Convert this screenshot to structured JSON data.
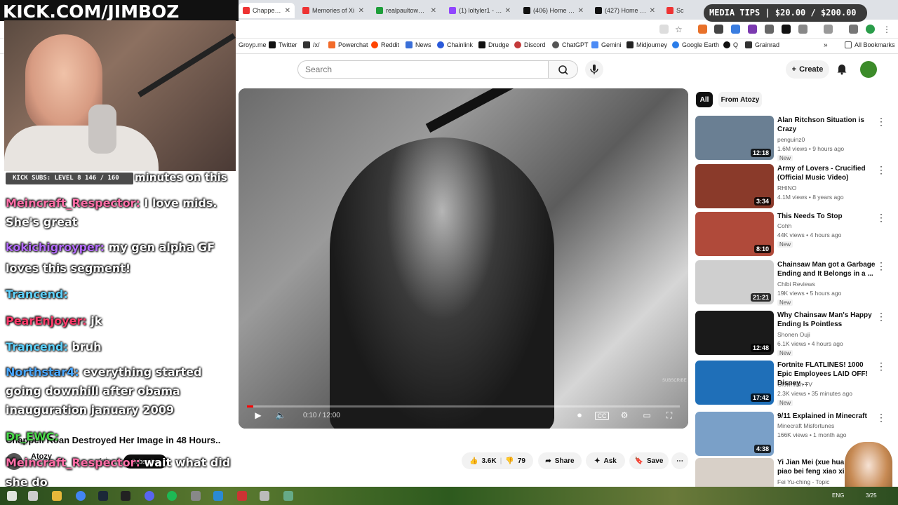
{
  "browser": {
    "tabs": [
      {
        "label": "Chappell Ro",
        "active": true,
        "color": "#e33"
      },
      {
        "label": "Memories of Xi",
        "color": "#e33"
      },
      {
        "label": "realpaultown Si",
        "color": "#1e9e3a"
      },
      {
        "label": "(1) loltyler1 - Te",
        "color": "#9146ff"
      },
      {
        "label": "(406) Home / X",
        "color": "#111"
      },
      {
        "label": "(427) Home / X",
        "color": "#111"
      },
      {
        "label": "Sc",
        "color": "#e33"
      }
    ],
    "bookmarks": [
      {
        "label": "Groyp.me",
        "color": "#8a5a44"
      },
      {
        "label": "Twitter",
        "color": "#111"
      },
      {
        "label": "/x/",
        "color": "#333"
      },
      {
        "label": "Powerchat",
        "color": "#f26b2a"
      },
      {
        "label": "Reddit",
        "color": "#ff4500"
      },
      {
        "label": "News",
        "color": "#3a6fd8"
      },
      {
        "label": "Chainlink",
        "color": "#2a5ada"
      },
      {
        "label": "Drudge",
        "color": "#111"
      },
      {
        "label": "Discord",
        "color": "#c43a3a"
      },
      {
        "label": "ChatGPT",
        "color": "#555"
      },
      {
        "label": "Gemini",
        "color": "#4c8bf5"
      },
      {
        "label": "Midjourney",
        "color": "#222"
      },
      {
        "label": "Google Earth",
        "color": "#2b7de9"
      },
      {
        "label": "Q",
        "color": "#111"
      },
      {
        "label": "Grainrad",
        "color": "#333"
      }
    ],
    "all_bookmarks": "All Bookmarks"
  },
  "youtube": {
    "search_placeholder": "Search",
    "create_label": "Create",
    "chips": [
      "All",
      "From Atozy"
    ],
    "video": {
      "title": "Chappell Roan Destroyed Her Image in 48 Hours..",
      "time": "0:10 / 12:00",
      "progress": 0.014,
      "watermark": "SUBSCRIBE",
      "channel": "Atozy",
      "join": "Join",
      "subscribe": "Subscribe",
      "likes": "3.6K",
      "dislikes": "79",
      "share": "Share",
      "ask": "Ask",
      "save": "Save"
    },
    "recommendations": [
      {
        "title": "Alan Ritchson Situation is Crazy",
        "channel": "penguinz0",
        "meta": "1.6M views • 9 hours ago",
        "badge": "New",
        "duration": "12:18",
        "thumb": "#6a7f93"
      },
      {
        "title": "Army of Lovers - Crucified (Official Music Video)",
        "channel": "RHINO",
        "meta": "4.1M views • 8 years ago",
        "badge": "",
        "duration": "3:34",
        "thumb": "#8a3a2a"
      },
      {
        "title": "This Needs To Stop",
        "channel": "Cohh",
        "meta": "44K views • 4 hours ago",
        "badge": "New",
        "duration": "8:10",
        "thumb": "#b04a3a"
      },
      {
        "title": "Chainsaw Man got a Garbage Ending and It Belongs in a ...",
        "channel": "Chibi Reviews",
        "meta": "19K views • 5 hours ago",
        "badge": "New",
        "duration": "21:21",
        "thumb": "#cfcfcf"
      },
      {
        "title": "Why Chainsaw Man's Happy Ending Is Pointless",
        "channel": "Shonen Ouji",
        "meta": "6.1K views • 4 hours ago",
        "badge": "New",
        "duration": "12:48",
        "thumb": "#1a1a1a"
      },
      {
        "title": "Fortnite FLATLINES! 1000 Epic Employees LAID OFF! Disney ...",
        "channel": "Clownfish TV",
        "meta": "2.3K views • 35 minutes ago",
        "badge": "New",
        "duration": "17:42",
        "thumb": "#1f6fb8"
      },
      {
        "title": "9/11 Explained in Minecraft",
        "channel": "Minecraft Misfortunes",
        "meta": "166K views • 1 month ago",
        "badge": "",
        "duration": "4:38",
        "thumb": "#7aa0c8"
      },
      {
        "title": "Yi Jian Mei (xue hua piao piao bei feng xiao xiao)",
        "channel": "Fei Yu-ching - Topic",
        "meta": "",
        "badge": "",
        "duration": "",
        "thumb": "#d8d0c8"
      }
    ]
  },
  "overlay": {
    "banner": "KICK.COM/JIMBOZ",
    "subs": "KICK SUBS: LEVEL 8 146 / 160",
    "media_tips": "MEDIA TIPS | $20.00 / $200.00",
    "chat": [
      {
        "user": "",
        "msg": "minutes on this",
        "color": "#ffffff"
      },
      {
        "user": "Meincraft_Respector:",
        "msg": "I love mids.",
        "color": "#ff6fa8"
      },
      {
        "user": "",
        "msg": "She's great",
        "color": "#ffffff"
      },
      {
        "user": "kokichigroyper:",
        "msg": "my gen alpha GF",
        "color": "#b46cff"
      },
      {
        "user": "",
        "msg": "loves this segment!",
        "color": "#ffffff"
      },
      {
        "user": "Trancend:",
        "msg": "",
        "color": "#5fd3ff"
      },
      {
        "user": "PearEnjoyer:",
        "msg": "jk",
        "color": "#ff3b6b"
      },
      {
        "user": "Trancend:",
        "msg": "bruh",
        "color": "#5fd3ff"
      },
      {
        "user": "Northstar4:",
        "msg": "everything started",
        "color": "#4aa8ff"
      },
      {
        "user": "",
        "msg": "going downhill after obama",
        "color": "#ffffff"
      },
      {
        "user": "",
        "msg": "inauguration january 2009",
        "color": "#ffffff"
      },
      {
        "user": "Dr_EWC:",
        "msg": "",
        "color": "#4ad94a"
      },
      {
        "user": "Meincraft_Respector:",
        "msg": "wait what did",
        "color": "#ff6fa8"
      },
      {
        "user": "",
        "msg": "she do",
        "color": "#ffffff"
      }
    ]
  },
  "taskbar": {
    "lang": "ENG",
    "date": "3/25"
  }
}
